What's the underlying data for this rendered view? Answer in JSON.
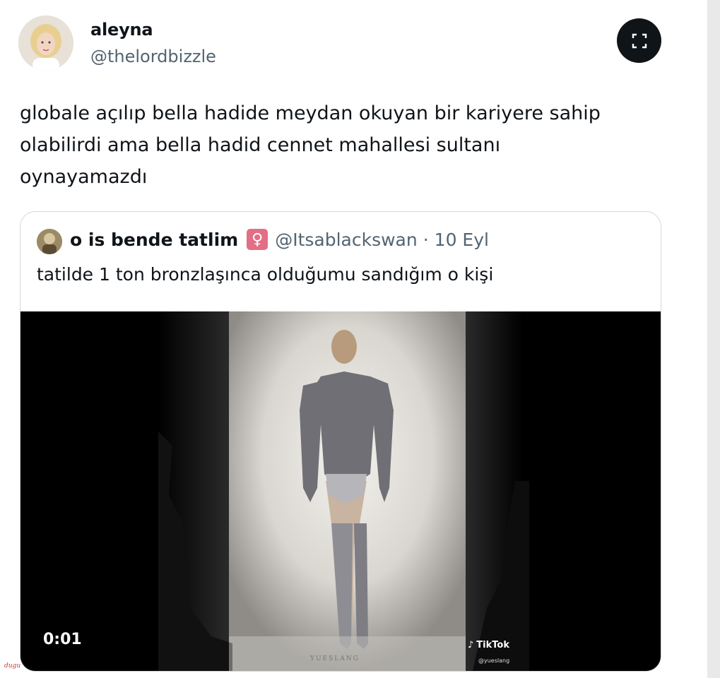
{
  "author": {
    "name": "aleyna",
    "handle": "@thelordbizzle"
  },
  "expand_icon": "fullscreen-expand-icon",
  "tweet": {
    "lines": [
      "globale açılıp bella hadide meydan okuyan bir kariyere sahip",
      "olabilirdi ama bella hadid cennet mahallesi sultanı",
      "oynayamazdı"
    ]
  },
  "quote": {
    "name": "o is bende tatlim",
    "badge": "♀",
    "handle": "@Itsablackswan",
    "separator": "·",
    "date": "10 Eyl",
    "text": "tatilde 1 ton bronzlaşınca olduğumu sandığım o kişi"
  },
  "video": {
    "timestamp": "0:01",
    "tiktok_label": "TikTok",
    "tiktok_handle": "@yueslang",
    "watermark": "YUESLANG"
  },
  "corner_tag": "dugu",
  "colors": {
    "text": "#0f1419",
    "secondary": "#536471",
    "border": "#cfd9de",
    "badge": "#e36f85"
  }
}
